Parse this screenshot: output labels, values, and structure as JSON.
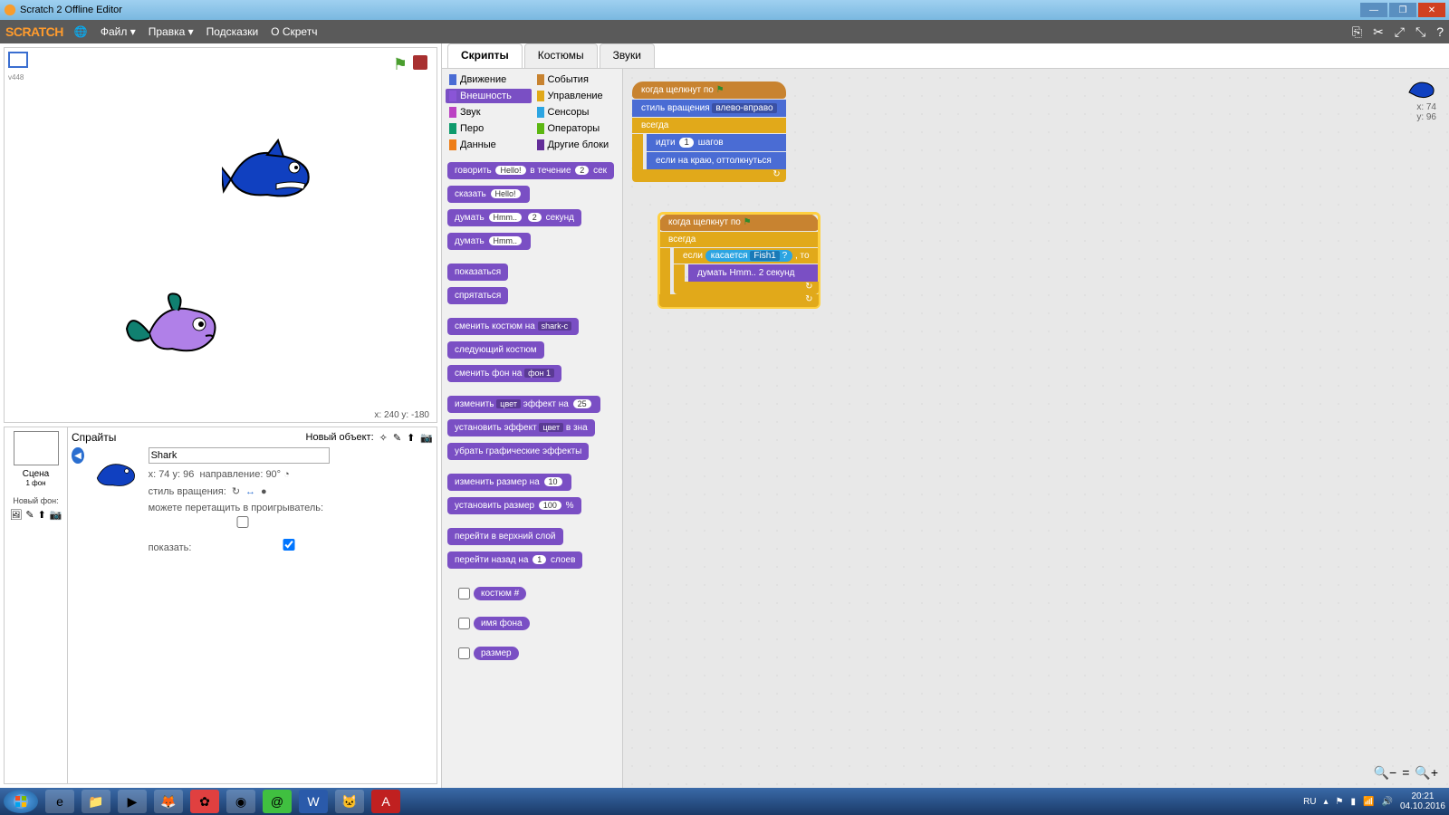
{
  "window": {
    "title": "Scratch 2 Offline Editor"
  },
  "menu": {
    "logo": "SCRATCH",
    "items": [
      "Файл ▾",
      "Правка ▾",
      "Подсказки",
      "О Скретч"
    ]
  },
  "stage": {
    "version": "v448",
    "coords": "x: 240   y: -180"
  },
  "sprite_panel": {
    "header": "Спрайты",
    "new_object": "Новый объект:",
    "scene_label": "Сцена",
    "scene_sub": "1 фон",
    "new_backdrop": "Новый фон:"
  },
  "sprite_info": {
    "name": "Shark",
    "xy": "x: 74   y: 96",
    "dir_label": "направление:",
    "dir": "90°",
    "rot_label": "стиль вращения:",
    "drag_label": "можете перетащить в проигрыватель:",
    "show_label": "показать:"
  },
  "tabs": {
    "scripts": "Скрипты",
    "costumes": "Костюмы",
    "sounds": "Звуки"
  },
  "categories": {
    "motion": "Движение",
    "looks": "Внешность",
    "sound": "Звук",
    "pen": "Перо",
    "data": "Данные",
    "events": "События",
    "control": "Управление",
    "sensing": "Сенсоры",
    "operators": "Операторы",
    "more": "Другие блоки"
  },
  "palette_blocks": {
    "say_for": "говорить",
    "say_for_txt": "Hello!",
    "say_for_mid": "в течение",
    "say_for_sec": "2",
    "say_for_suf": "сек",
    "say": "сказать",
    "say_txt": "Hello!",
    "think_for": "думать",
    "think_for_txt": "Hmm..",
    "think_for_sec": "2",
    "think_for_suf": "секунд",
    "think": "думать",
    "think_txt": "Hmm..",
    "show": "показаться",
    "hide": "спрятаться",
    "switch_cost": "сменить костюм на",
    "switch_cost_dd": "shark-c",
    "next_cost": "следующий костюм",
    "switch_bg": "сменить фон на",
    "switch_bg_dd": "фон 1",
    "change_eff": "изменить",
    "change_eff_dd": "цвет",
    "change_eff_mid": "эффект на",
    "change_eff_val": "25",
    "set_eff": "установить эффект",
    "set_eff_dd": "цвет",
    "set_eff_mid": "в зна",
    "clear_eff": "убрать графические эффекты",
    "change_size": "изменить размер на",
    "change_size_val": "10",
    "set_size": "установить размер",
    "set_size_val": "100",
    "set_size_suf": "%",
    "front": "перейти в верхний слой",
    "back": "перейти назад на",
    "back_val": "1",
    "back_suf": "слоев",
    "rep_cost": "костюм #",
    "rep_bg": "имя фона",
    "rep_size": "размер"
  },
  "script1": {
    "hat": "когда щелкнут по",
    "b1": "стиль вращения",
    "b1_dd": "влево-вправо",
    "forever": "всегда",
    "move": "идти",
    "move_val": "1",
    "move_suf": "шагов",
    "bounce": "если на краю, оттолкнуться"
  },
  "script2": {
    "hat": "когда щелкнут по",
    "forever": "всегда",
    "if": "если",
    "touch": "касается",
    "touch_dd": "Fish1",
    "q": "?",
    "then": ", то",
    "think": "думать",
    "think_txt": "Hmm..",
    "think_val": "2",
    "think_suf": "секунд"
  },
  "script_coords": {
    "x": "x: 74",
    "y": "y: 96"
  },
  "taskbar": {
    "lang": "RU",
    "time": "20:21",
    "date": "04.10.2016"
  }
}
